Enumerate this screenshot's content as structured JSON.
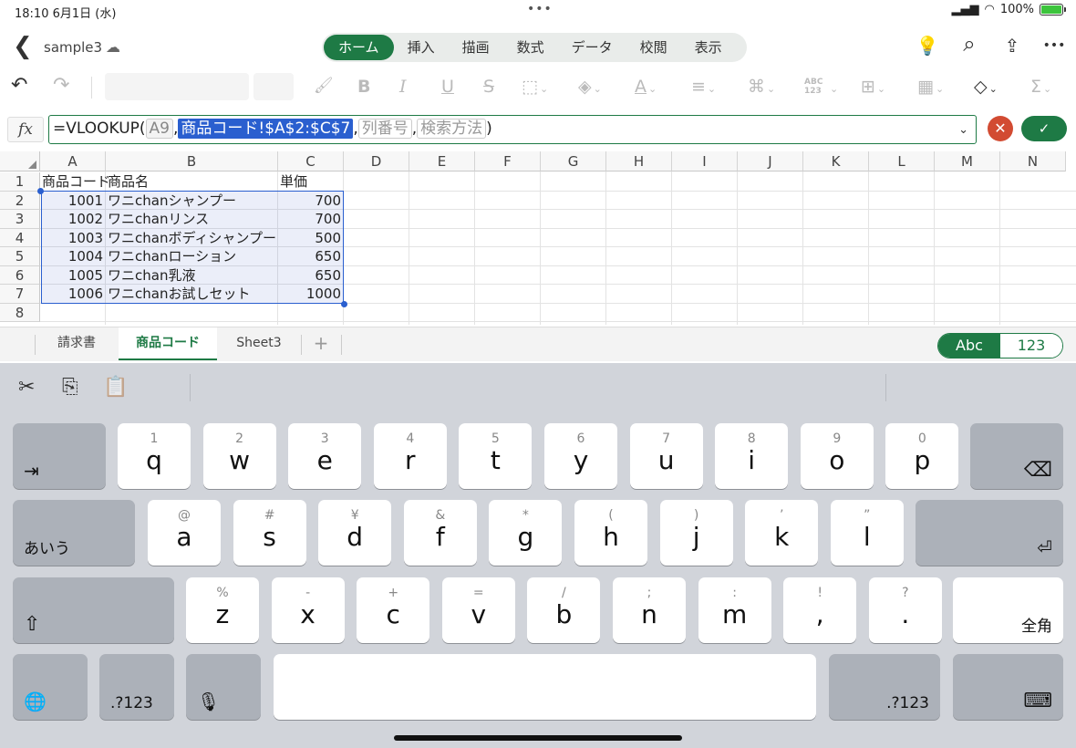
{
  "status": {
    "time": "18:10",
    "date": "6月1日 (水)",
    "battery": "100%",
    "dots": "•••"
  },
  "file": {
    "name": "sample3",
    "back_glyph": "❮",
    "cloud_glyph": "☁"
  },
  "ribbon_tabs": [
    {
      "label": "ホーム",
      "active": true
    },
    {
      "label": "挿入"
    },
    {
      "label": "描画"
    },
    {
      "label": "数式"
    },
    {
      "label": "データ"
    },
    {
      "label": "校閲"
    },
    {
      "label": "表示"
    }
  ],
  "top_icons": {
    "idea": "💡",
    "search": "⌕",
    "share": "⇪",
    "more": "•••"
  },
  "toolbar_glyphs": {
    "undo": "↶",
    "redo": "↷",
    "brush": "🖌",
    "bold": "B",
    "italic": "I",
    "underline": "U",
    "strike": "S",
    "border": "⬚",
    "fill": "◈",
    "fontcolor": "A",
    "align": "≡",
    "wrap": "⌘",
    "numfmt": "ABC\n123",
    "table": "⊞",
    "cells": "▦",
    "erase": "◇",
    "sum": "Σ"
  },
  "formula": {
    "fx": "fx",
    "prefix": "=VLOOKUP(",
    "arg1": "A9",
    "sep1": ",",
    "arg2": "商品コード!$A$2:$C$7",
    "sep2": ",",
    "arg3": "列番号",
    "sep3": ",",
    "arg4": "検索方法",
    "suffix": ")",
    "dropdown": "⌄",
    "cancel": "✕",
    "ok": "✓"
  },
  "grid": {
    "col_headers": [
      "A",
      "B",
      "C",
      "D",
      "E",
      "F",
      "G",
      "H",
      "I",
      "J",
      "K",
      "L",
      "M",
      "N"
    ],
    "row_headers": [
      "1",
      "2",
      "3",
      "4",
      "5",
      "6",
      "7",
      "8"
    ],
    "header_row": {
      "a": "商品コード",
      "b": "商品名",
      "c": "単価"
    },
    "rows": [
      {
        "code": "1001",
        "name": "ワニchanシャンプー",
        "price": "700"
      },
      {
        "code": "1002",
        "name": "ワニchanリンス",
        "price": "700"
      },
      {
        "code": "1003",
        "name": "ワニchanボディシャンプー",
        "price": "500"
      },
      {
        "code": "1004",
        "name": "ワニchanローション",
        "price": "650"
      },
      {
        "code": "1005",
        "name": "ワニchan乳液",
        "price": "650"
      },
      {
        "code": "1006",
        "name": "ワニchanお試しセット",
        "price": "1000"
      }
    ]
  },
  "sheets": [
    {
      "label": "請求書"
    },
    {
      "label": "商品コード",
      "active": true
    },
    {
      "label": "Sheet3"
    }
  ],
  "sheet_add": "+",
  "input_mode": {
    "abc": "Abc",
    "num": "123"
  },
  "keyboard": {
    "clip": {
      "cut": "✂",
      "copy": "⎘",
      "paste": "📋"
    },
    "row1": [
      {
        "s": "1",
        "m": "q"
      },
      {
        "s": "2",
        "m": "w"
      },
      {
        "s": "3",
        "m": "e"
      },
      {
        "s": "4",
        "m": "r"
      },
      {
        "s": "5",
        "m": "t"
      },
      {
        "s": "6",
        "m": "y"
      },
      {
        "s": "7",
        "m": "u"
      },
      {
        "s": "8",
        "m": "i"
      },
      {
        "s": "9",
        "m": "o"
      },
      {
        "s": "0",
        "m": "p"
      }
    ],
    "row2": [
      {
        "s": "@",
        "m": "a"
      },
      {
        "s": "#",
        "m": "s"
      },
      {
        "s": "¥",
        "m": "d"
      },
      {
        "s": "&",
        "m": "f"
      },
      {
        "s": "*",
        "m": "g"
      },
      {
        "s": "(",
        "m": "h"
      },
      {
        "s": ")",
        "m": "j"
      },
      {
        "s": "’",
        "m": "k"
      },
      {
        "s": "”",
        "m": "l"
      }
    ],
    "row3": [
      {
        "s": "%",
        "m": "z"
      },
      {
        "s": "-",
        "m": "x"
      },
      {
        "s": "+",
        "m": "c"
      },
      {
        "s": "=",
        "m": "v"
      },
      {
        "s": "/",
        "m": "b"
      },
      {
        "s": ";",
        "m": "n"
      },
      {
        "s": ":",
        "m": "m"
      },
      {
        "s": "!",
        "m": ","
      },
      {
        "s": "?",
        "m": "."
      }
    ],
    "tab": "⇥",
    "delete": "⌫",
    "kana": "あいう",
    "return": "⏎",
    "shift": "⇧",
    "zenkaku": "全角",
    "globe": "🌐",
    "num_left": ".?123",
    "mic": "🎙",
    "num_right": ".?123",
    "hide": "⌨"
  }
}
